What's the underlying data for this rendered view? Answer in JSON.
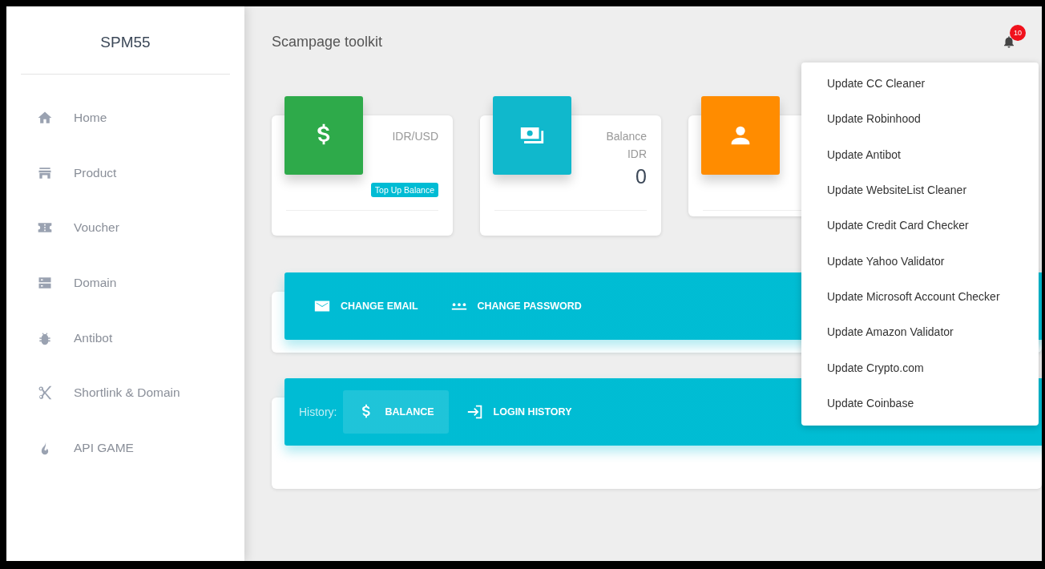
{
  "sidebar": {
    "brand": "SPM55",
    "items": [
      {
        "label": "Home"
      },
      {
        "label": "Product"
      },
      {
        "label": "Voucher"
      },
      {
        "label": "Domain"
      },
      {
        "label": "Antibot"
      },
      {
        "label": "Shortlink & Domain"
      },
      {
        "label": "API GAME"
      }
    ]
  },
  "header": {
    "title": "Scampage toolkit",
    "notifications": {
      "count": "10"
    }
  },
  "stat_cards": [
    {
      "kind": "rate",
      "color": "#2eaa4a",
      "label": "IDR/USD",
      "badge": "Top Up Balance"
    },
    {
      "kind": "balance",
      "color": "#10b8cc",
      "label": "Balance",
      "unit": "IDR",
      "value": "0"
    },
    {
      "kind": "user",
      "color": "#ff8c00"
    }
  ],
  "account_tabs": [
    {
      "label": "CHANGE EMAIL"
    },
    {
      "label": "CHANGE PASSWORD"
    }
  ],
  "history": {
    "label": "History:",
    "tabs": [
      {
        "label": "BALANCE",
        "selected": true
      },
      {
        "label": "LOGIN HISTORY",
        "selected": false
      }
    ]
  },
  "notification_menu": [
    {
      "label": "Update CC Cleaner"
    },
    {
      "label": "Update Robinhood"
    },
    {
      "label": "Update Antibot"
    },
    {
      "label": "Update WebsiteList Cleaner"
    },
    {
      "label": "Update Credit Card Checker"
    },
    {
      "label": "Update Yahoo Validator"
    },
    {
      "label": "Update Microsoft Account Checker"
    },
    {
      "label": "Update Amazon Validator"
    },
    {
      "label": "Update Crypto.com"
    },
    {
      "label": "Update Coinbase"
    }
  ]
}
